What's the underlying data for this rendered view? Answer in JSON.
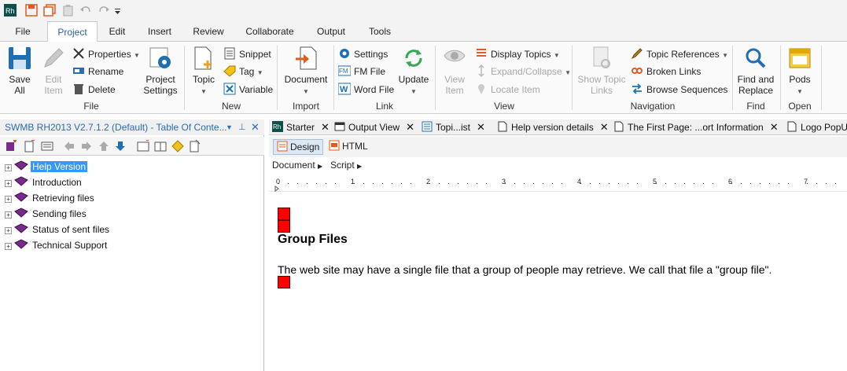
{
  "menu": {
    "tabs": [
      "File",
      "Project",
      "Edit",
      "Insert",
      "Review",
      "Collaborate",
      "Output",
      "Tools"
    ],
    "active": "Project"
  },
  "ribbon": {
    "file_group": {
      "save_all": "Save\nAll",
      "edit_item": "Edit\nItem",
      "properties": "Properties",
      "rename": "Rename",
      "delete": "Delete",
      "project_settings": "Project\nSettings",
      "label": "File"
    },
    "new_group": {
      "topic": "Topic",
      "snippet": "Snippet",
      "tag": "Tag",
      "variable": "Variable",
      "label": "New"
    },
    "import_group": {
      "document": "Document",
      "label": "Import"
    },
    "link_group": {
      "settings": "Settings",
      "fm_file": "FM File",
      "word_file": "Word File",
      "update": "Update",
      "label": "Link"
    },
    "view_group": {
      "view_item": "View\nItem",
      "display_topics": "Display Topics",
      "expand_collapse": "Expand/Collapse",
      "locate_item": "Locate Item",
      "label": "View"
    },
    "navigation_group": {
      "show_topic_links": "Show Topic\nLinks",
      "topic_references": "Topic References",
      "broken_links": "Broken Links",
      "browse_sequences": "Browse Sequences",
      "label": "Navigation"
    },
    "find_group": {
      "find_replace": "Find and\nReplace",
      "label": "Find"
    },
    "open_group": {
      "pods": "Pods",
      "label": "Open"
    }
  },
  "left_pane": {
    "title": "SWMB RH2013 V2.7.1.2 (Default) - Table Of Conte...",
    "tree": [
      {
        "label": "Help Version",
        "selected": true
      },
      {
        "label": "Introduction",
        "selected": false
      },
      {
        "label": "Retrieving files",
        "selected": false
      },
      {
        "label": "Sending files",
        "selected": false
      },
      {
        "label": "Status of sent files",
        "selected": false
      },
      {
        "label": "Technical Support",
        "selected": false
      }
    ]
  },
  "doc_tabs": [
    "Starter",
    "Output View",
    "Topi...ist",
    "Help version details",
    "The First Page: ...ort Information",
    "Logo PopU"
  ],
  "editor": {
    "modes": [
      "Design",
      "HTML"
    ],
    "active_mode": "Design",
    "menus": [
      "Document",
      "Script"
    ],
    "ruler_numbers": [
      "0",
      "1",
      "2",
      "3",
      "4",
      "5",
      "6",
      "7"
    ],
    "heading": "Group Files",
    "paragraph": "The web site may have a single file that a group of people may retrieve. We call that file a \"group file\"."
  },
  "colors": {
    "accent": "#2b6cb5",
    "selection": "#3399ff",
    "placeholder_red": "#ff0000"
  }
}
